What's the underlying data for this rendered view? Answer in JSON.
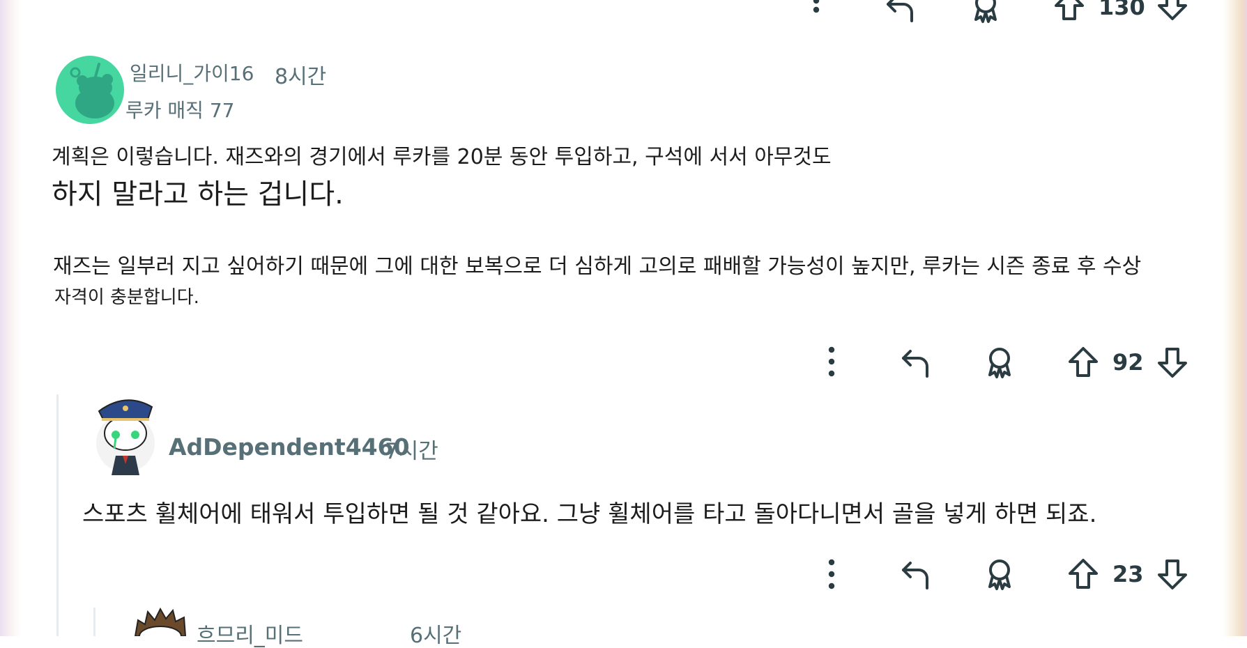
{
  "top_actions": {
    "vote_count": "130"
  },
  "comments": [
    {
      "username": "일리니_가이16",
      "time": "8시간",
      "flair": "루카 매직 77",
      "body_line1": "계획은 이렇습니다. 재즈와의 경기에서 루카를 20분 동안 투입하고, 구석에 서서 아무것도",
      "body_line2": "하지 말라고 하는 겁니다.",
      "body_line3": "재즈는 일부러 지고 싶어하기 때문에 그에 대한 보복으로 더 심하게 고의로 패배할 가능성이 높지만, 루카는 시즌 종료 후 수상",
      "body_line4": "자격이 충분합니다.",
      "vote_count": "92"
    },
    {
      "username": "AdDependent4460",
      "time": "7시간",
      "body": "스포츠 휠체어에 태워서 투입하면 될 것 같아요. 그냥 휠체어를 타고 돌아다니면서 골을 넣게 하면 되죠.",
      "vote_count": "23"
    },
    {
      "username_partial": "흐므리_미드",
      "time_partial": "6시간"
    }
  ],
  "icons": [
    "more-options-icon",
    "reply-icon",
    "award-icon",
    "upvote-icon",
    "downvote-icon"
  ],
  "colors": {
    "action_icon": "#2a3c42",
    "meta_text": "#576f76",
    "avatar_green": "#46d6a0",
    "thread_line": "#e5ebee"
  }
}
